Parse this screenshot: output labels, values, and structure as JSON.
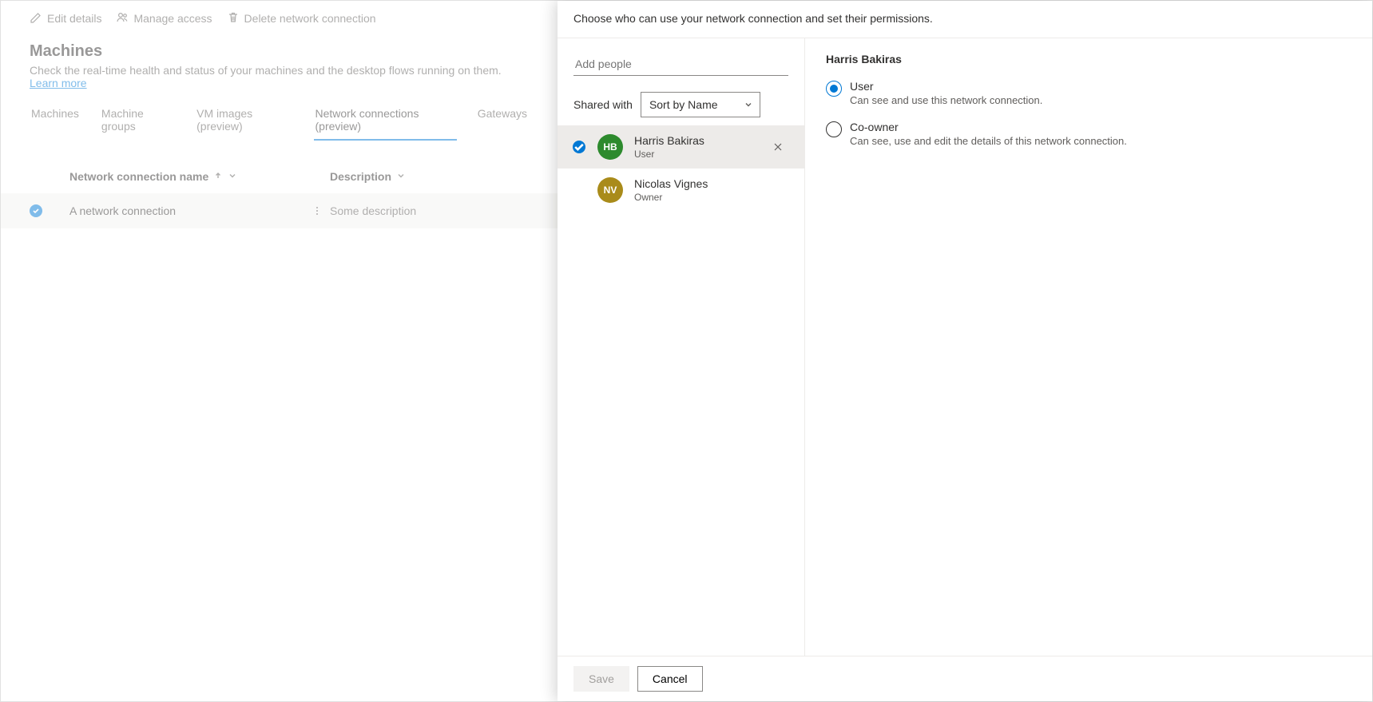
{
  "toolbar": {
    "edit_label": "Edit details",
    "manage_label": "Manage access",
    "delete_label": "Delete network connection"
  },
  "page": {
    "title": "Machines",
    "description": "Check the real-time health and status of your machines and the desktop flows running on them. ",
    "learn_more": "Learn more"
  },
  "tabs": [
    {
      "label": "Machines"
    },
    {
      "label": "Machine groups"
    },
    {
      "label": "VM images (preview)"
    },
    {
      "label": "Network connections (preview)"
    },
    {
      "label": "Gateways"
    }
  ],
  "table": {
    "col_name": "Network connection name",
    "col_desc": "Description",
    "rows": [
      {
        "name": "A network connection",
        "description": "Some description"
      }
    ]
  },
  "panel": {
    "header": "Choose who can use your network connection and set their permissions.",
    "add_placeholder": "Add people",
    "shared_with_label": "Shared with",
    "sort_value": "Sort by Name",
    "people": [
      {
        "initials": "HB",
        "name": "Harris Bakiras",
        "role": "User",
        "color": "#2d8a2d",
        "selected": true
      },
      {
        "initials": "NV",
        "name": "Nicolas Vignes",
        "role": "Owner",
        "color": "#a98b1a",
        "selected": false
      }
    ],
    "permissions": {
      "title": "Harris Bakiras",
      "options": [
        {
          "label": "User",
          "desc": "Can see and use this network connection.",
          "checked": true
        },
        {
          "label": "Co-owner",
          "desc": "Can see, use and edit the details of this network connection.",
          "checked": false
        }
      ]
    },
    "footer": {
      "save": "Save",
      "cancel": "Cancel"
    }
  }
}
